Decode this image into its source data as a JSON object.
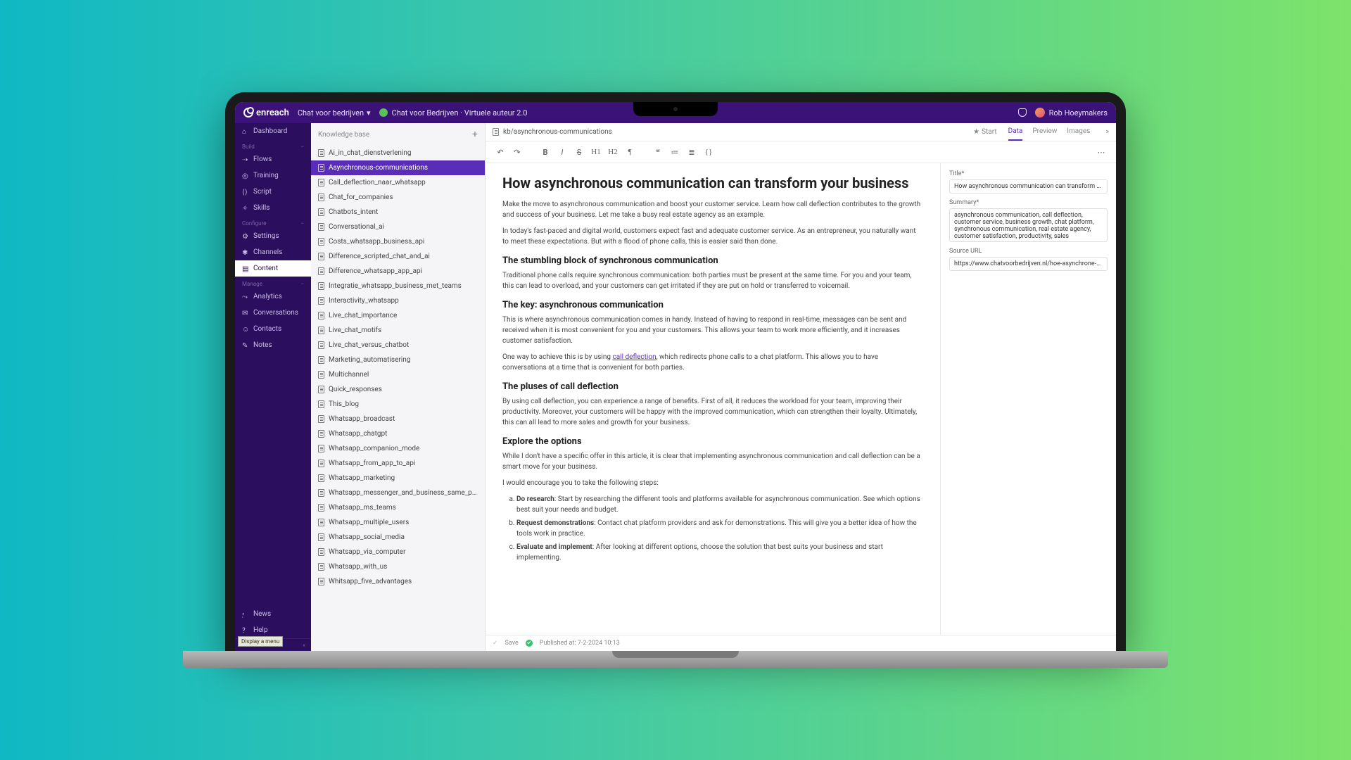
{
  "topbar": {
    "brand": "enreach",
    "project_label": "Chat voor bedrijven",
    "breadcrumb": "Chat voor Bedrijven · Virtuele auteur 2.0",
    "user_name": "Rob Hoeymakers"
  },
  "sidebar": {
    "dashboard": "Dashboard",
    "sections": [
      {
        "title": "Build",
        "items": [
          "Flows",
          "Training",
          "Script",
          "Skills"
        ]
      },
      {
        "title": "Configure",
        "items": [
          "Settings",
          "Channels",
          "Content"
        ]
      },
      {
        "title": "Manage",
        "items": [
          "Analytics",
          "Conversations",
          "Contacts",
          "Notes"
        ]
      }
    ],
    "bottom": [
      "News",
      "Help"
    ],
    "tooltip": "Display a menu"
  },
  "kb": {
    "header": "Knowledge base",
    "items": [
      "Ai_in_chat_dienstverlening",
      "Asynchronous-communications",
      "Call_deflection_naar_whatsapp",
      "Chat_for_companies",
      "Chatbots_intent",
      "Conversational_ai",
      "Costs_whatsapp_business_api",
      "Difference_scripted_chat_and_ai",
      "Difference_whatsapp_app_api",
      "Integratie_whatsapp_business_met_teams",
      "Interactivity_whatsapp",
      "Live_chat_importance",
      "Live_chat_motifs",
      "Live_chat_versus_chatbot",
      "Marketing_automatisering",
      "Multichannel",
      "Quick_responses",
      "This_blog",
      "Whatsapp_broadcast",
      "Whatsapp_chatgpt",
      "Whatsapp_companion_mode",
      "Whatsapp_from_app_to_api",
      "Whatsapp_marketing",
      "Whatsapp_messenger_and_business_same_p…",
      "Whatsapp_ms_teams",
      "Whatsapp_multiple_users",
      "Whatsapp_social_media",
      "Whatsapp_via_computer",
      "Whatsapp_with_us",
      "Whitsapp_five_advantages"
    ],
    "active_index": 1
  },
  "editor": {
    "path": "kb/asynchronous-communications",
    "star_label": "Start",
    "tabs": [
      "Data",
      "Preview",
      "Images"
    ],
    "active_tab": 0,
    "save_label": "Save",
    "published_label": "Published at: 7-2-2024 10:13"
  },
  "article": {
    "h1": "How asynchronous communication can transform your business",
    "p1": "Make the move to asynchronous communication and boost your customer service. Learn how call deflection contributes to the growth and success of your business. Let me take a busy real estate agency as an example.",
    "p2": "In today's fast-paced and digital world, customers expect fast and adequate customer service. As an entrepreneur, you naturally want to meet these expectations. But with a flood of phone calls, this is easier said than done.",
    "h2a": "The stumbling block of synchronous communication",
    "p3": "Traditional phone calls require synchronous communication: both parties must be present at the same time. For you and your team, this can lead to overload, and your customers can get irritated if they are put on hold or transferred to voicemail.",
    "h2b": "The key: asynchronous communication",
    "p4": "This is where asynchronous communication comes in handy. Instead of having to respond in real-time, messages can be sent and received when it is most convenient for you and your customers. This allows your team to work more efficiently, and it increases customer satisfaction.",
    "p5a": "One way to achieve this is by using ",
    "p5link": "call deflection",
    "p5b": ", which redirects phone calls to a chat platform. This allows you to have conversations at a time that is convenient for both parties.",
    "h2c": "The pluses of call deflection",
    "p6": "By using call deflection, you can experience a range of benefits. First of all, it reduces the workload for your team, improving their productivity. Moreover, your customers will be happy with the improved communication, which can strengthen their loyalty. Ultimately, this can all lead to more sales and growth for your business.",
    "h2d": "Explore the options",
    "p7": "While I don't have a specific offer in this article, it is clear that implementing asynchronous communication and call deflection can be a smart move for your business.",
    "p8": "I would encourage you to take the following steps:",
    "li1b": "Do research",
    "li1": ": Start by researching the different tools and platforms available for asynchronous communication. See which options best suit your needs and budget.",
    "li2b": "Request demonstrations",
    "li2": ": Contact chat platform providers and ask for demonstrations. This will give you a better idea of how the tools work in practice.",
    "li3b": "Evaluate and implement",
    "li3": ": After looking at different options, choose the solution that best suits your business and start implementing."
  },
  "meta": {
    "title_label": "Title*",
    "title_value": "How asynchronous communication can transform your busin",
    "summary_label": "Summary*",
    "summary_value": "asynchronous communication, call deflection, customer service, business growth, chat platform, synchronous communication, real estate agency, customer satisfaction, productivity, sales",
    "source_label": "Source URL",
    "source_value": "https://www.chatvoorbedrijven.nl/hoe-asynchrone-communic"
  }
}
